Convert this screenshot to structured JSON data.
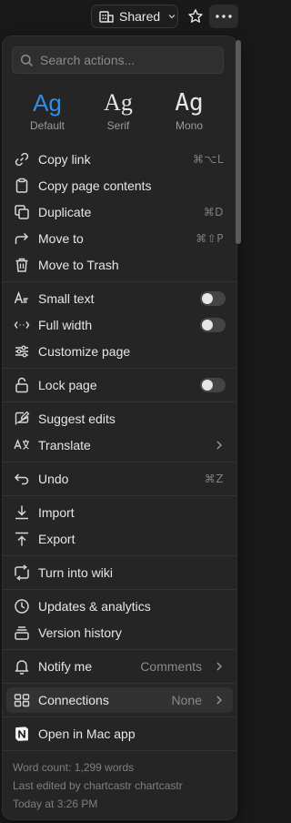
{
  "topbar": {
    "shared_label": "Shared"
  },
  "search": {
    "placeholder": "Search actions..."
  },
  "font_options": [
    {
      "sample": "Ag",
      "label": "Default",
      "selected": true
    },
    {
      "sample": "Ag",
      "label": "Serif",
      "selected": false
    },
    {
      "sample": "Ag",
      "label": "Mono",
      "selected": false
    }
  ],
  "items": {
    "copy_link": {
      "label": "Copy link",
      "shortcut": "⌘⌥L"
    },
    "copy_page_contents": {
      "label": "Copy page contents"
    },
    "duplicate": {
      "label": "Duplicate",
      "shortcut": "⌘D"
    },
    "move_to": {
      "label": "Move to",
      "shortcut": "⌘⇧P"
    },
    "move_to_trash": {
      "label": "Move to Trash"
    },
    "small_text": {
      "label": "Small text",
      "enabled": false
    },
    "full_width": {
      "label": "Full width",
      "enabled": false
    },
    "customize_page": {
      "label": "Customize page"
    },
    "lock_page": {
      "label": "Lock page",
      "enabled": false
    },
    "suggest_edits": {
      "label": "Suggest edits"
    },
    "translate": {
      "label": "Translate"
    },
    "undo": {
      "label": "Undo",
      "shortcut": "⌘Z"
    },
    "import": {
      "label": "Import"
    },
    "export": {
      "label": "Export"
    },
    "turn_into_wiki": {
      "label": "Turn into wiki"
    },
    "updates_analytics": {
      "label": "Updates & analytics"
    },
    "version_history": {
      "label": "Version history"
    },
    "notify_me": {
      "label": "Notify me",
      "value": "Comments"
    },
    "connections": {
      "label": "Connections",
      "value": "None"
    },
    "open_in_mac_app": {
      "label": "Open in Mac app"
    }
  },
  "footer": {
    "word_count": "Word count: 1,299 words",
    "last_edited": "Last edited by chartcastr chartcastr",
    "edited_time": "Today at 3:26 PM"
  },
  "colors": {
    "accent": "#2f8ee8",
    "background": "#191919",
    "menu_background": "#252525"
  }
}
